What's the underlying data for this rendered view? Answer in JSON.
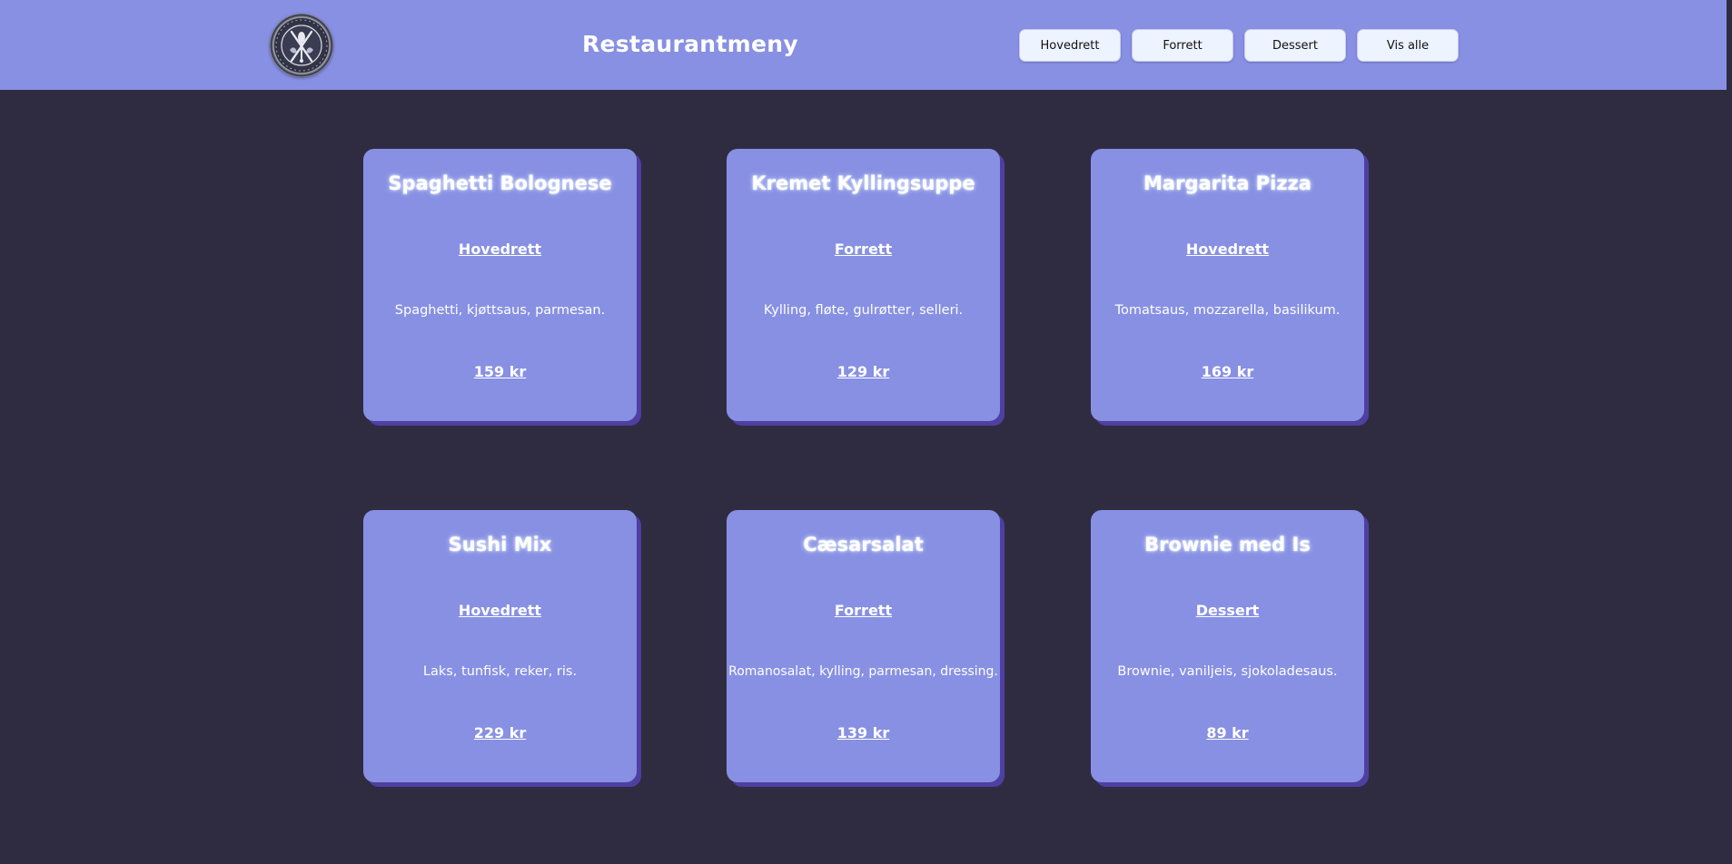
{
  "header": {
    "title": "Restaurantmeny",
    "logo_icon": "restaurant-emblem-icon",
    "nav": [
      {
        "label": "Hovedrett"
      },
      {
        "label": "Forrett"
      },
      {
        "label": "Dessert"
      },
      {
        "label": "Vis alle"
      }
    ]
  },
  "colors": {
    "background": "#2f2c42",
    "header": "#8790e3",
    "card": "#8790e3",
    "card_shadow": "#4e3fa1",
    "button": "#edf3ff"
  },
  "menu": [
    {
      "name": "Spaghetti Bolognese",
      "category": "Hovedrett",
      "description": "Spaghetti, kjøttsaus, parmesan.",
      "price": "159 kr"
    },
    {
      "name": "Kremet Kyllingsuppe",
      "category": "Forrett",
      "description": "Kylling, fløte, gulrøtter, selleri.",
      "price": "129 kr"
    },
    {
      "name": "Margarita Pizza",
      "category": "Hovedrett",
      "description": "Tomatsaus, mozzarella, basilikum.",
      "price": "169 kr"
    },
    {
      "name": "Sushi Mix",
      "category": "Hovedrett",
      "description": "Laks, tunfisk, reker, ris.",
      "price": "229 kr"
    },
    {
      "name": "Cæsarsalat",
      "category": "Forrett",
      "description": "Romanosalat, kylling, parmesan, dressing.",
      "price": "139 kr"
    },
    {
      "name": "Brownie med Is",
      "category": "Dessert",
      "description": "Brownie, vaniljeis, sjokoladesaus.",
      "price": "89 kr"
    }
  ]
}
